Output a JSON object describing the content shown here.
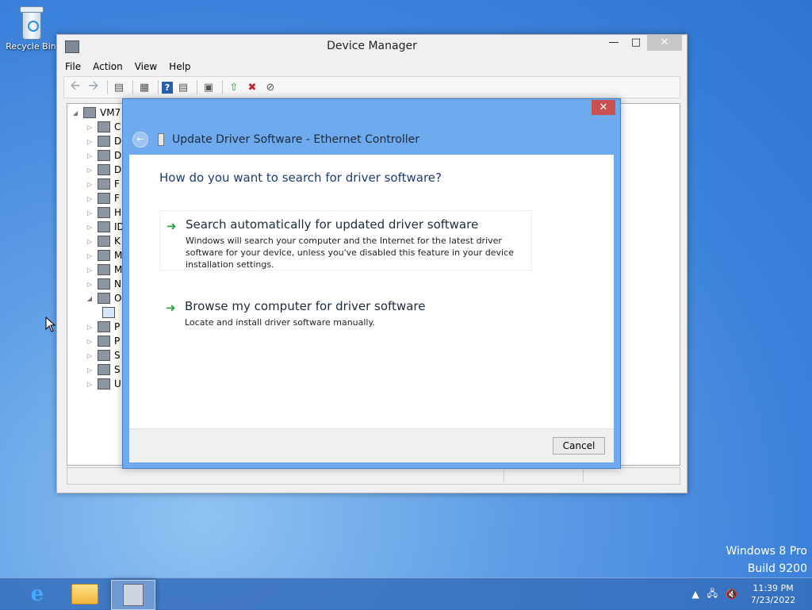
{
  "desktop": {
    "recycle_bin": "Recycle Bin",
    "watermark_line1": "Windows 8 Pro",
    "watermark_line2": "Build 9200"
  },
  "device_manager": {
    "title": "Device Manager",
    "menu": [
      "File",
      "Action",
      "View",
      "Help"
    ],
    "tree_root": "VM7",
    "tree_items": [
      "C",
      "D",
      "D",
      "D",
      "F",
      "F",
      "H",
      "ID",
      "K",
      "M",
      "M",
      "N",
      "O",
      "",
      "P",
      "P",
      "S",
      "S",
      "U"
    ]
  },
  "dialog": {
    "title": "Update Driver Software - Ethernet Controller",
    "question": "How do you want to search for driver software?",
    "option1_heading": "Search automatically for updated driver software",
    "option1_desc": "Windows will search your computer and the Internet for the latest driver software for your device, unless you've disabled this feature in your device installation settings.",
    "option2_heading": "Browse my computer for driver software",
    "option2_desc": "Locate and install driver software manually.",
    "cancel_label": "Cancel"
  },
  "taskbar": {
    "time": "11:39 PM",
    "date": "7/23/2022"
  },
  "colors": {
    "dialog_frame": "#6fa9ee",
    "close_button": "#c75050",
    "question_text": "#1e3c78",
    "arrow_green": "#2aa13d"
  }
}
